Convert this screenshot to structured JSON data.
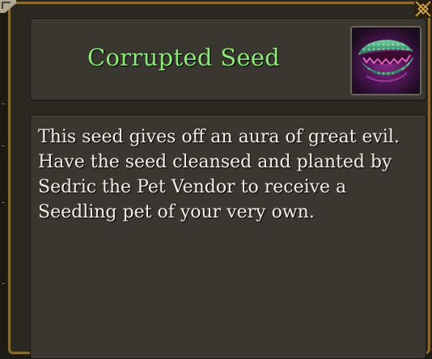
{
  "item": {
    "name": "Corrupted Seed",
    "name_color": "#8ee87a",
    "icon": "corrupted-seed-icon",
    "description": "This seed gives off an aura of great evil.\nHave the seed cleansed and planted by\nSedric the Pet Vendor to receive a\nSeedling pet of your very own."
  },
  "theme": {
    "border_color": "#8c6a2a",
    "panel_color": "#3a3730",
    "text_color": "#f2efe6"
  }
}
